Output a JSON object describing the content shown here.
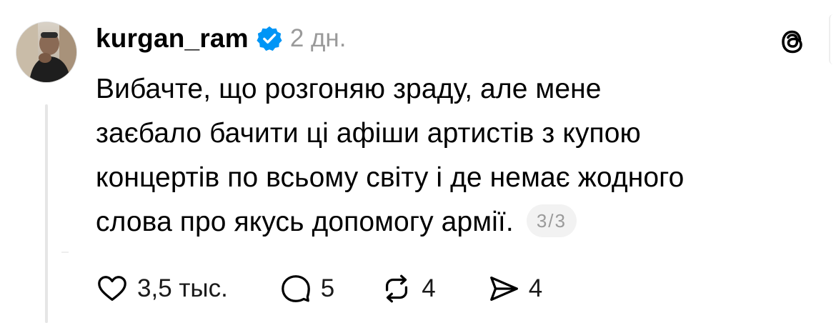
{
  "post": {
    "username": "kurgan_ram",
    "verified": true,
    "time": "2 дн.",
    "text": "Вибачте, що розгоняю зраду, але мене\nзаєбало бачити ці афіши артистів з купою\nконцертів по всьому світу і де немає жодного\nслова про якусь допомогу армії.",
    "counter": "3/3"
  },
  "actions": {
    "likes": "3,5 тыс.",
    "comments": "5",
    "reposts": "4",
    "shares": "4"
  },
  "icons": {
    "verified": "verified-badge-icon",
    "threads": "threads-logo-icon",
    "like": "heart-icon",
    "comment": "comment-bubble-icon",
    "repost": "repost-icon",
    "share": "send-icon"
  },
  "colors": {
    "verified_blue": "#0095f6",
    "secondary_text": "#9a9a9a",
    "badge_bg": "#f2f2f2"
  }
}
